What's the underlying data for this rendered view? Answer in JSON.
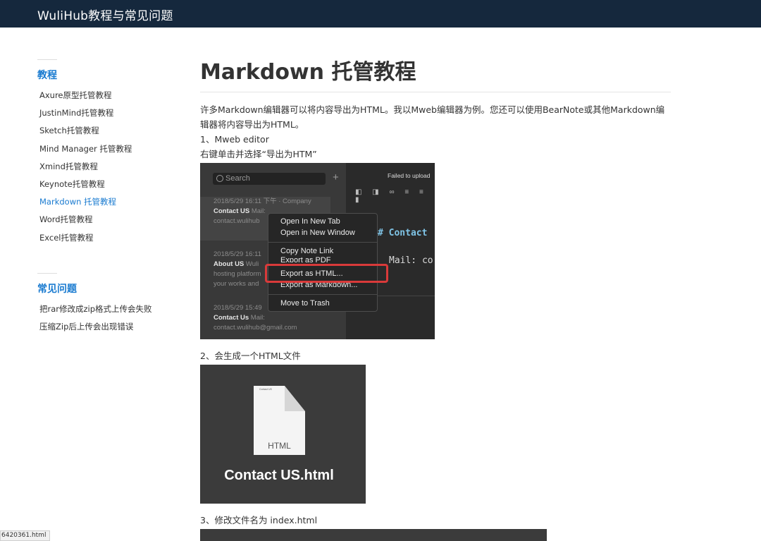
{
  "site": {
    "brand": "WuliHub教程与常见问题"
  },
  "sidebar": {
    "section1_title": "教程",
    "items": [
      {
        "label": "Axure原型托管教程"
      },
      {
        "label": "JustinMind托管教程"
      },
      {
        "label": "Sketch托管教程"
      },
      {
        "label": "Mind Manager 托管教程"
      },
      {
        "label": "Xmind托管教程"
      },
      {
        "label": "Keynote托管教程"
      },
      {
        "label": "Markdown 托管教程",
        "active": true
      },
      {
        "label": "Word托管教程"
      },
      {
        "label": "Excel托管教程"
      }
    ],
    "section2_title": "常见问题",
    "faq": [
      {
        "label": "把rar修改成zip格式上传会失败"
      },
      {
        "label": "压缩Zip后上传会出现错误"
      }
    ]
  },
  "main": {
    "title": "Markdown 托管教程",
    "intro": "许多Markdown编辑器可以将内容导出为HTML。我以Mweb编辑器为例。您还可以使用BearNote或其他Markdown编辑器将内容导出为HTML。",
    "step1": "1、Mweb editor",
    "step1_desc": "右键单击并选择“导出为HTM”",
    "step2": "2、会生成一个HTML文件",
    "step3": "3、修改文件名为 index.html"
  },
  "screenshot1": {
    "search_placeholder": "Search",
    "plus": "+",
    "failed": "Failed to upload",
    "toolbar_icons": "◧ ◨ ∞ ≡ ≡ ▮",
    "notes": [
      {
        "meta": "2018/5/29 16:11 下午  · Company",
        "title": "Contact US",
        "rest": "Mail:",
        "line2": "contact.wulihub"
      },
      {
        "meta": "2018/5/29 16:11",
        "title": "About US",
        "rest": "Wuli",
        "line2": "hosting platform",
        "line3": "your works and"
      },
      {
        "meta": "2018/5/29 15:49",
        "title": "Contact Us",
        "rest": "Mail:",
        "line2": "contact.wulihub@gmail.com"
      }
    ],
    "editor_heading": "# Contact",
    "editor_mail": "Mail: co",
    "menu": [
      "Open In New Tab",
      "Open in New Window",
      "Copy Note Link",
      "Export as PDF",
      "Export as HTML...",
      "Export as Markdown...",
      "Move to Trash"
    ]
  },
  "screenshot2": {
    "icon_label": "HTML",
    "icon_mini": "Contact US",
    "filename": "Contact US.html"
  },
  "statusbar": {
    "text": "6420361.html"
  }
}
